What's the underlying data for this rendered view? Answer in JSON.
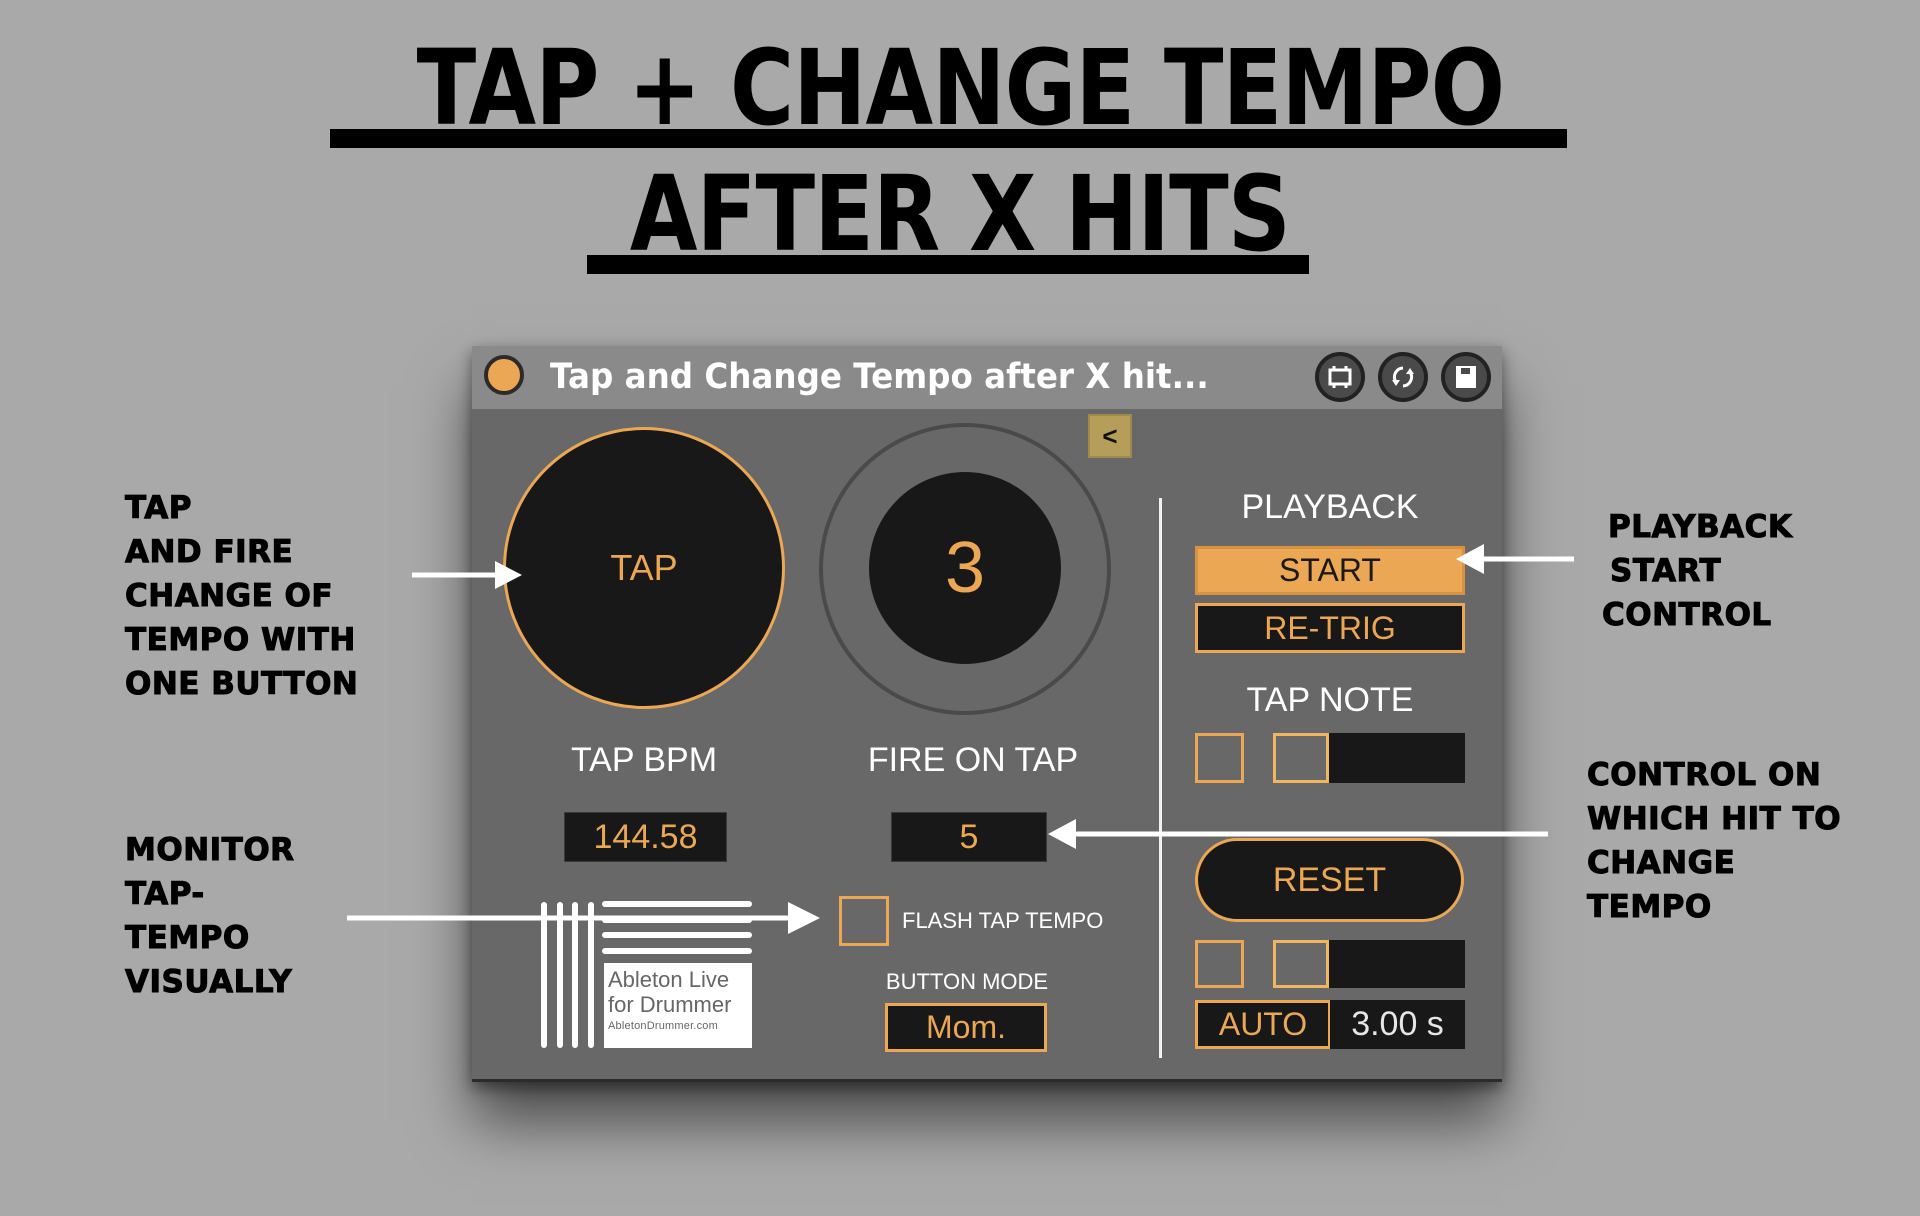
{
  "headline": {
    "line1": "TAP + CHANGE TEMPO",
    "line2": "AFTER X HITS"
  },
  "annotations": {
    "tap": [
      "TAP",
      "AND FIRE",
      "CHANGE OF",
      "TEMPO WITH",
      "ONE BUTTON"
    ],
    "monitor": [
      "MONITOR",
      "TAP-",
      "TEMPO",
      "VISUALLY"
    ],
    "playback": [
      "PLAYBACK",
      "START",
      "CONTROL"
    ],
    "control": [
      "CONTROL ON",
      "WHICH HIT TO",
      "CHANGE",
      "TEMPO"
    ]
  },
  "device": {
    "title": "Tap and Change Tempo after X hit...",
    "titlebar_icons": [
      "freeze-icon",
      "hot-swap-icon",
      "save-icon"
    ],
    "collapse_label": "<",
    "tap_pad_label": "TAP",
    "counter_value": "3",
    "tap_bpm_label": "TAP BPM",
    "tap_bpm_value": "144.58",
    "fire_on_tap_label": "FIRE ON TAP",
    "fire_on_tap_value": "5",
    "flash_tap_tempo_label": "FLASH TAP TEMPO",
    "button_mode_label": "BUTTON MODE",
    "button_mode_value": "Mom.",
    "playback_label": "PLAYBACK",
    "start_label": "START",
    "retrig_label": "RE-TRIG",
    "tap_note_label": "TAP NOTE",
    "reset_label": "RESET",
    "auto_label": "AUTO",
    "auto_time": "3.00 s",
    "logo": {
      "line1": "Ableton Live",
      "line2": "for Drummer",
      "line3": "AbletonDrummer.com"
    }
  },
  "colors": {
    "accent": "#eca754",
    "panel": "#686868",
    "titlebar": "#8a8a8a",
    "background": "#a9a9a9"
  }
}
